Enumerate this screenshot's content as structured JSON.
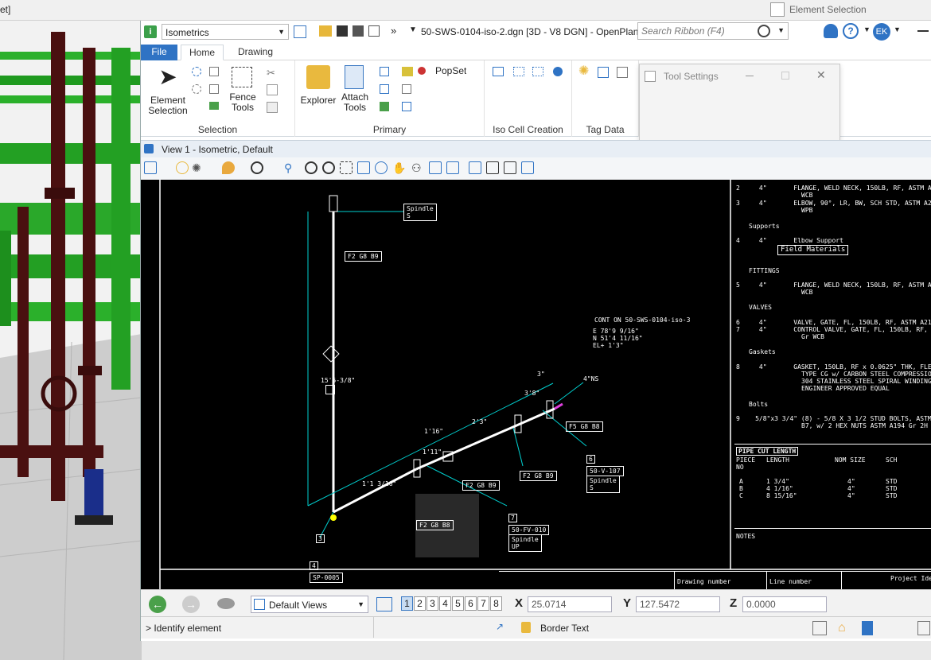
{
  "topstrip": {
    "left_text": "et]",
    "element_selection": "Element Selection"
  },
  "titlebar": {
    "workflow": "Isometrics",
    "overflow": "»",
    "file_title": "50-SWS-0104-iso-2.dgn [3D - V8 DGN] - OpenPlant",
    "search_placeholder": "Search Ribbon (F4)",
    "user_initials": "EK"
  },
  "tabs": [
    {
      "label": "File"
    },
    {
      "label": "Home"
    },
    {
      "label": "Drawing"
    }
  ],
  "ribbon": {
    "selection": {
      "element_selection": "Element\nSelection",
      "fence_tools": "Fence\nTools",
      "label": "Selection"
    },
    "primary": {
      "explorer": "Explorer",
      "attach_tools": "Attach\nTools",
      "popset": "PopSet",
      "label": "Primary"
    },
    "iso_cell": {
      "label": "Iso Cell Creation"
    },
    "tag_data": {
      "label": "Tag Data"
    }
  },
  "tool_settings": {
    "title": "Tool Settings"
  },
  "view": {
    "title": "View 1 - Isometric, Default"
  },
  "iso": {
    "cont_on": "CONT ON 50-SWS-0104-iso-3",
    "coord_e": "E 78'9 9/16\"",
    "coord_n": "N 51'4 11/16\"",
    "coord_el": "EL+ 1'3\"",
    "ns": "4\"NS",
    "three": "3\"",
    "spindle_top": "Spindle\nS",
    "tag_f2g8b9_top": "F2 G8 B9",
    "tag_f5g8b8": "F5 G8 B8",
    "tag_f2g8b9_mid": "F2 G8 B9",
    "tag_f2g8b9_mid2": "F2 G8 B9",
    "tag_f2g8b8": "F2 G8 B8",
    "n6": "6",
    "v107": "50-V-107",
    "spindle_s": "Spindle\nS",
    "n7": "7",
    "fv010": "50-FV-010",
    "spindle_up": "Spindle\nUP",
    "n3": "3",
    "n4": "4",
    "sp0005": "SP-0005",
    "dim_vertical": "15'5-3/8\"",
    "dim_a": "1'1 3/16\"",
    "dim_b": "1'11\"",
    "dim_c": "2'3\"",
    "dim_d": "3'8\"",
    "dim_e": "1'16\""
  },
  "bom": {
    "rows": [
      {
        "pt": "2",
        "size": "4\"",
        "desc": "FLANGE, WELD NECK, 150LB, RF, ASTM A",
        "desc2": "WCB"
      },
      {
        "pt": "3",
        "size": "4\"",
        "desc": "ELBOW, 90°, LR, BW, SCH STD, ASTM A2",
        "desc2": "WPB"
      },
      {
        "pt": "4",
        "size": "4\"",
        "desc": "Elbow Support",
        "desc2": ""
      },
      {
        "pt": "5",
        "size": "4\"",
        "desc": "FLANGE, WELD NECK, 150LB, RF, ASTM A",
        "desc2": "WCB"
      },
      {
        "pt": "6",
        "size": "4\"",
        "desc": "VALVE, GATE, FL, 150LB, RF, ASTM A21",
        "desc2": ""
      },
      {
        "pt": "7",
        "size": "4\"",
        "desc": "CONTROL VALVE, GATE, FL, 150LB, RF,",
        "desc2": "Gr WCB"
      },
      {
        "pt": "8",
        "size": "4\"",
        "desc": "GASKET, 150LB, RF x 0.0625\" THK, FLE",
        "desc2": "TYPE CG w/ CARBON STEEL COMPRESSION",
        "desc3": "304 STAINLESS STEEL SPIRAL WINDING S",
        "desc4": "ENGINEER APPROVED EQUAL"
      },
      {
        "pt": "9",
        "size": "5/8\"x3 3/4\"",
        "desc": "(8) - 5/8 X 3 1/2 STUD BOLTS, ASTM A",
        "desc2": "B7, w/ 2 HEX NUTS ASTM A194 Gr 2H"
      }
    ],
    "supports": "Supports",
    "field_materials": "Field Materials",
    "fittings": "FITTINGS",
    "valves": "VALVES",
    "gaskets": "Gaskets",
    "bolts": "Bolts",
    "pipe_cut": "PIPE CUT LENGTH",
    "cut_headers": [
      "PIECE\nNO",
      "LENGTH",
      "NOM SIZE",
      "SCH"
    ],
    "cut_rows": [
      [
        "A",
        "1 3/4\"",
        "4\"",
        "STD"
      ],
      [
        "B",
        "4 1/16\"",
        "4\"",
        "STD"
      ],
      [
        "C",
        "8 15/16\"",
        "4\"",
        "STD"
      ]
    ],
    "notes": "NOTES",
    "drawing_number": "Drawing number",
    "line_number": "Line number",
    "project_id": "Project Ide"
  },
  "navbar": {
    "views": "Default Views",
    "pages": [
      "1",
      "2",
      "3",
      "4",
      "5",
      "6",
      "7",
      "8"
    ],
    "x_label": "X",
    "x_value": "25.0714",
    "y_label": "Y",
    "y_value": "127.5472",
    "z_label": "Z",
    "z_value": "0.0000"
  },
  "status": {
    "prompt": "> Identify element",
    "border_text": "Border Text"
  }
}
